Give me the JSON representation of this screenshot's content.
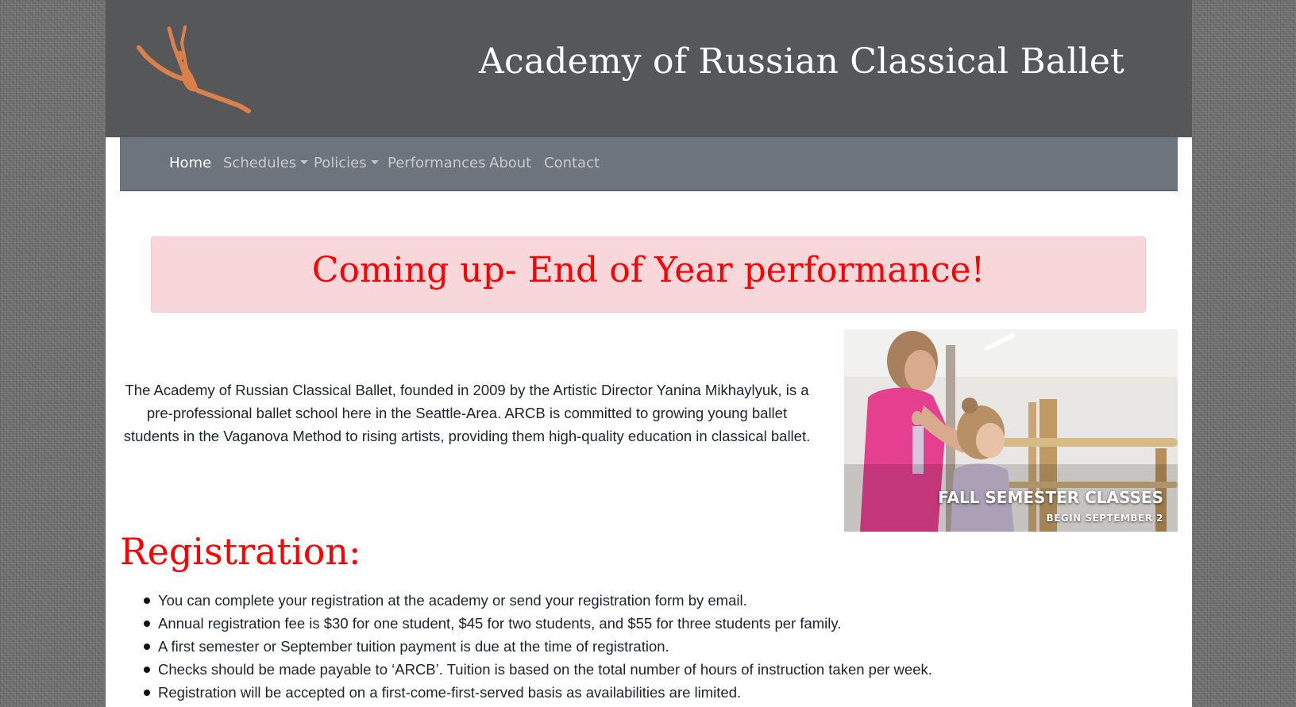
{
  "header": {
    "site_title": "Academy of Russian Classical Ballet",
    "logo_icon": "ballet-dancer-leap-icon",
    "colors": {
      "header_bg": "#565759",
      "logo": "#d9804b"
    }
  },
  "nav": {
    "items": [
      {
        "label": "Home",
        "active": true,
        "dropdown": false
      },
      {
        "label": "Schedules",
        "active": false,
        "dropdown": true
      },
      {
        "label": "Policies",
        "active": false,
        "dropdown": true
      },
      {
        "label": "Performances",
        "active": false,
        "dropdown": false
      },
      {
        "label": "About",
        "active": false,
        "dropdown": false
      },
      {
        "label": "Contact",
        "active": false,
        "dropdown": false
      }
    ],
    "colors": {
      "bg": "#6c757d"
    }
  },
  "alert": {
    "text": "Coming up- End of Year performance!",
    "colors": {
      "bg": "#f8d7da",
      "text": "#ff0000"
    }
  },
  "intro": {
    "text": "The Academy of Russian Classical Ballet, founded in 2009 by the Artistic Director Yanina Mikhaylyuk, is a pre-professional ballet school here in the Seattle-Area. ARCB is committed to growing young ballet students in the Vaganova Method to rising artists, providing them high-quality education in classical ballet."
  },
  "promo": {
    "caption_title": "FALL SEMESTER CLASSES",
    "caption_subtitle": "BEGIN SEPTEMBER 2"
  },
  "registration": {
    "heading": "Registration:",
    "items": [
      "You can complete your registration at the academy or send your registration form by email.",
      "Annual registration fee is $30 for one student, $45 for two students, and $55 for three students per family.",
      "A first semester or September tuition payment is due at the time of registration.",
      "Checks should be made payable to ‘ARCB’. Tuition is based on the total number of hours of instruction taken per week.",
      "Registration will be accepted on a first-come-first-served basis as availabilities are limited."
    ]
  }
}
